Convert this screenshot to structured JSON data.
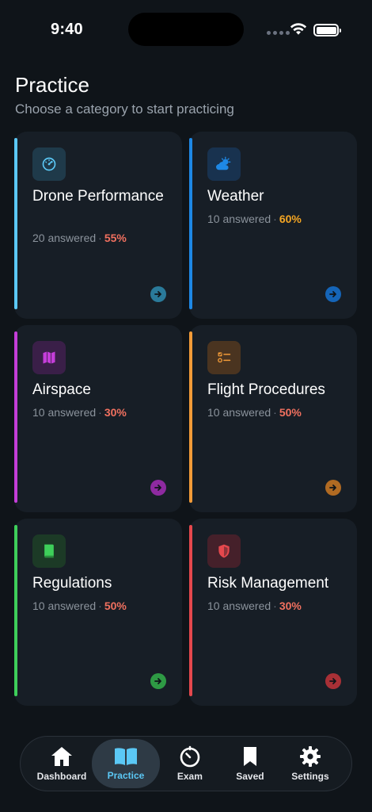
{
  "status_bar": {
    "time": "9:40"
  },
  "header": {
    "title": "Practice",
    "subtitle": "Choose a category to start practicing"
  },
  "categories": [
    {
      "title": "Drone Performance",
      "answered": "20 answered",
      "separator": "·",
      "percent": "55%",
      "accent": "#5bc8f5",
      "percent_color": "#f0705f",
      "icon": "speedometer-icon"
    },
    {
      "title": "Weather",
      "answered": "10 answered",
      "separator": "·",
      "percent": "60%",
      "accent": "#1e88e5",
      "percent_color": "#f5a623",
      "icon": "partly-cloudy-icon"
    },
    {
      "title": "Airspace",
      "answered": "10 answered",
      "separator": "·",
      "percent": "30%",
      "accent": "#c43ed8",
      "percent_color": "#f0705f",
      "icon": "map-icon"
    },
    {
      "title": "Flight Procedures",
      "answered": "10 answered",
      "separator": "·",
      "percent": "50%",
      "accent": "#f29b38",
      "percent_color": "#f0705f",
      "icon": "checklist-icon"
    },
    {
      "title": "Regulations",
      "answered": "10 answered",
      "separator": "·",
      "percent": "50%",
      "accent": "#3ecf5a",
      "percent_color": "#f0705f",
      "icon": "book-icon"
    },
    {
      "title": "Risk Management",
      "answered": "10 answered",
      "separator": "·",
      "percent": "30%",
      "accent": "#e5484d",
      "percent_color": "#f0705f",
      "icon": "shield-icon"
    }
  ],
  "tabs": [
    {
      "label": "Dashboard",
      "icon": "home-icon",
      "active": false
    },
    {
      "label": "Practice",
      "icon": "open-book-icon",
      "active": true
    },
    {
      "label": "Exam",
      "icon": "timer-icon",
      "active": false
    },
    {
      "label": "Saved",
      "icon": "bookmark-icon",
      "active": false
    },
    {
      "label": "Settings",
      "icon": "gear-icon",
      "active": false
    }
  ]
}
